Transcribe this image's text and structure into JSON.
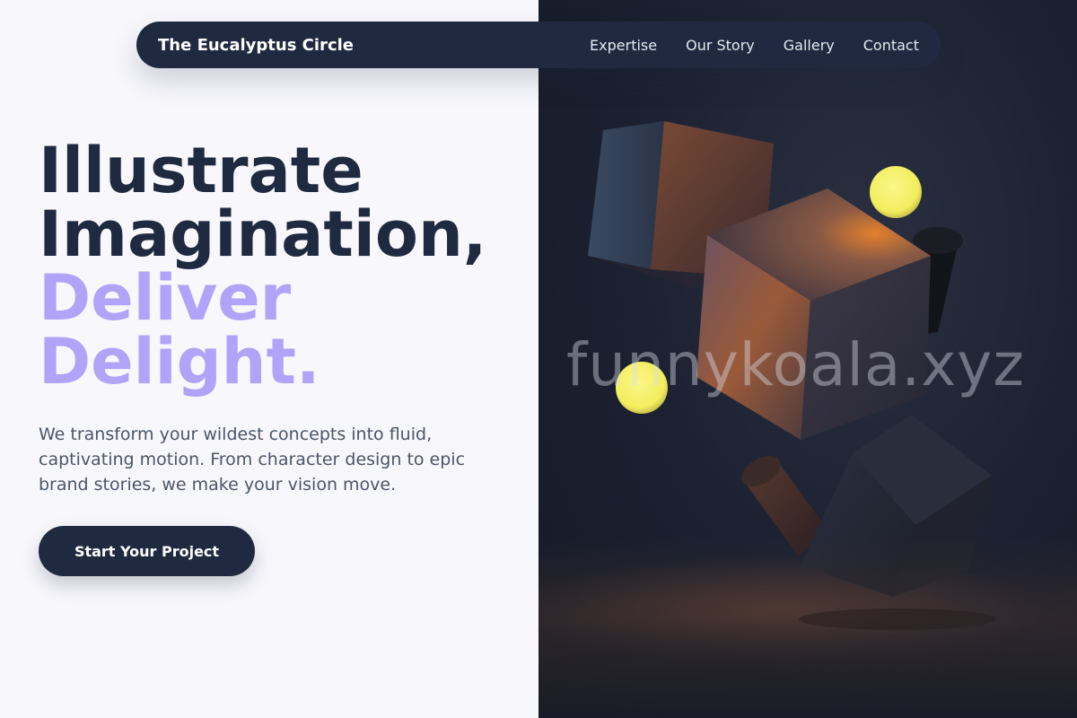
{
  "nav": {
    "brand": "The Eucalyptus Circle",
    "links": [
      "Expertise",
      "Our Story",
      "Gallery",
      "Contact"
    ]
  },
  "hero": {
    "line1": "Illustrate",
    "line2": "Imagination,",
    "line3": "Deliver",
    "line4": "Delight.",
    "description": "We transform your wildest concepts into fluid, captivating motion. From character design to epic brand stories, we make your vision move.",
    "cta_label": "Start Your Project"
  },
  "image": {
    "watermark": "funnykoala.xyz",
    "shapes": [
      "cube-icon",
      "cube-icon",
      "cube-icon",
      "sphere-icon",
      "sphere-icon",
      "cylinder-icon",
      "cylinder-icon"
    ]
  },
  "colors": {
    "navy": "#1f2a40",
    "accent": "#b1a3f7",
    "background": "#f7f7fc",
    "sphere": "#f7f26e"
  }
}
